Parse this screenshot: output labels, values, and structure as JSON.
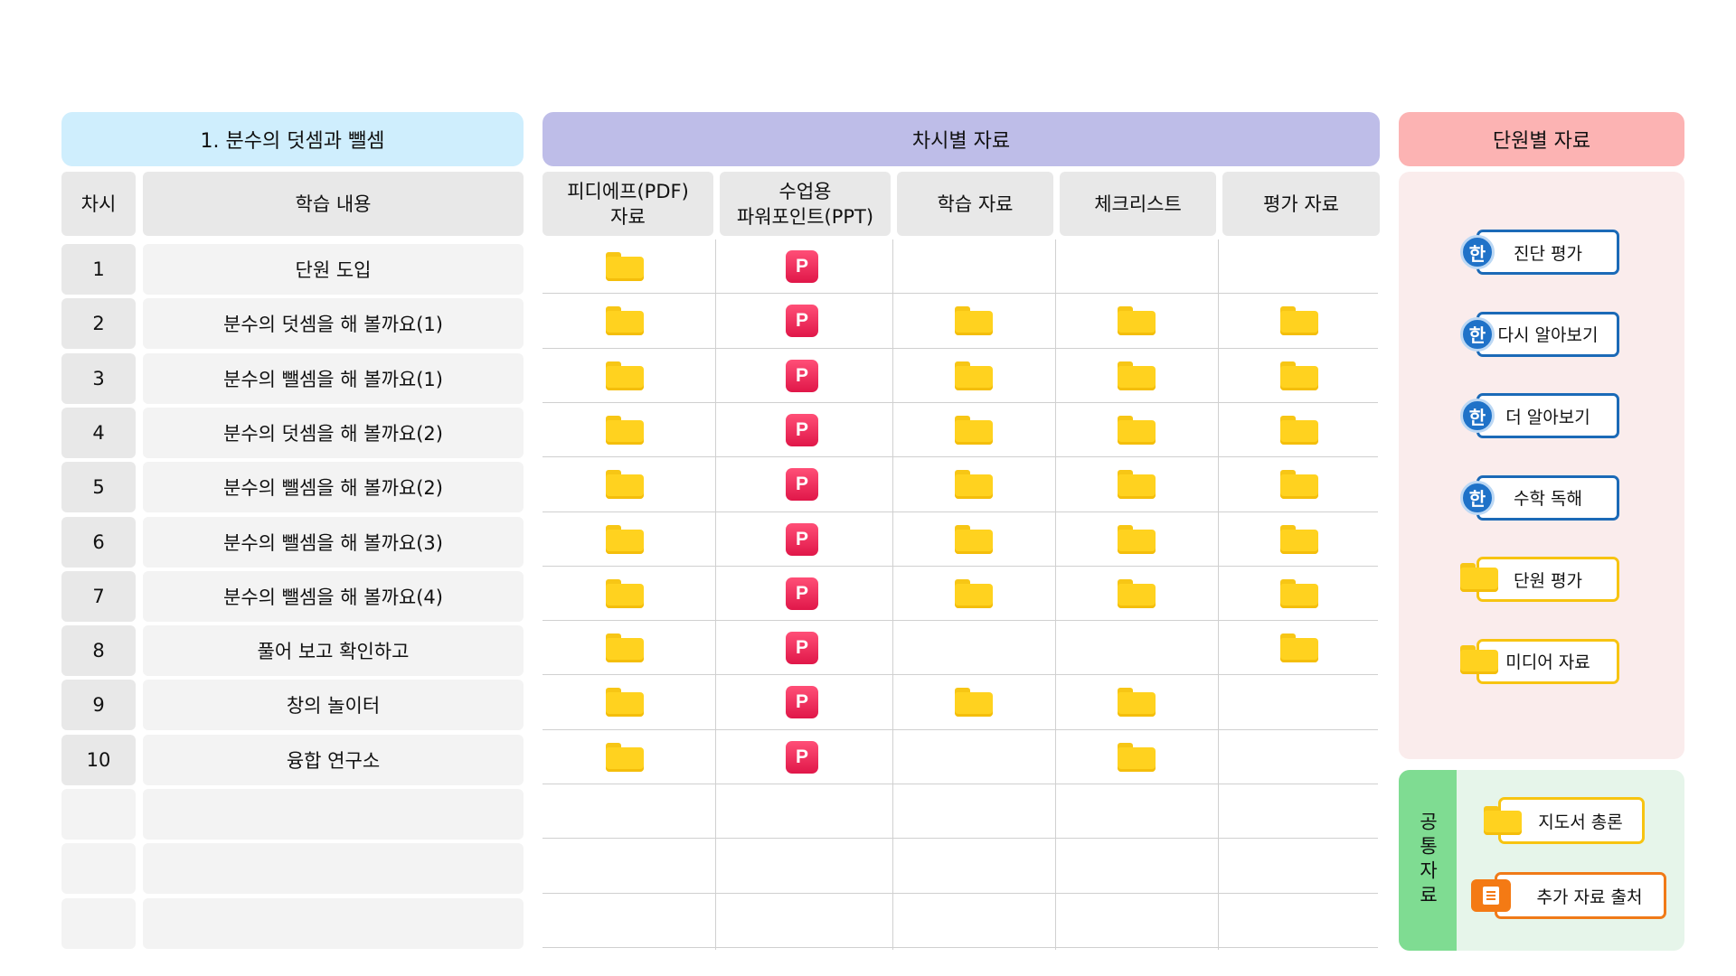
{
  "headers": {
    "unit_title": "1. 분수의 덧셈과 뺄셈",
    "lesson_materials": "차시별 자료",
    "unit_materials": "단원별 자료"
  },
  "columns": {
    "period": "차시",
    "content": "학습 내용",
    "pdf": "피디에프(PDF)\n자료",
    "ppt": "수업용\n파워포인트(PPT)",
    "study": "학습 자료",
    "checklist": "체크리스트",
    "evaluation": "평가 자료"
  },
  "rows": [
    {
      "num": "1",
      "content": "단원 도입",
      "pdf": true,
      "ppt": true,
      "study": false,
      "check": false,
      "eval": false
    },
    {
      "num": "2",
      "content": "분수의 덧셈을 해 볼까요(1)",
      "pdf": true,
      "ppt": true,
      "study": true,
      "check": true,
      "eval": true
    },
    {
      "num": "3",
      "content": "분수의 뺄셈을 해 볼까요(1)",
      "pdf": true,
      "ppt": true,
      "study": true,
      "check": true,
      "eval": true
    },
    {
      "num": "4",
      "content": "분수의 덧셈을 해 볼까요(2)",
      "pdf": true,
      "ppt": true,
      "study": true,
      "check": true,
      "eval": true
    },
    {
      "num": "5",
      "content": "분수의 뺄셈을 해 볼까요(2)",
      "pdf": true,
      "ppt": true,
      "study": true,
      "check": true,
      "eval": true
    },
    {
      "num": "6",
      "content": "분수의 뺄셈을 해 볼까요(3)",
      "pdf": true,
      "ppt": true,
      "study": true,
      "check": true,
      "eval": true
    },
    {
      "num": "7",
      "content": "분수의 뺄셈을 해 볼까요(4)",
      "pdf": true,
      "ppt": true,
      "study": true,
      "check": true,
      "eval": true
    },
    {
      "num": "8",
      "content": "풀어 보고 확인하고",
      "pdf": true,
      "ppt": true,
      "study": false,
      "check": false,
      "eval": true
    },
    {
      "num": "9",
      "content": "창의 놀이터",
      "pdf": true,
      "ppt": true,
      "study": true,
      "check": true,
      "eval": false
    },
    {
      "num": "10",
      "content": "융합 연구소",
      "pdf": true,
      "ppt": true,
      "study": false,
      "check": true,
      "eval": false
    }
  ],
  "ppt_glyph": "P",
  "unit_resources": [
    {
      "label": "진단 평가",
      "icon": "han-circle-icon",
      "style": "blue"
    },
    {
      "label": "다시 알아보기",
      "icon": "han-circle-icon",
      "style": "blue"
    },
    {
      "label": "더 알아보기",
      "icon": "han-circle-icon",
      "style": "blue"
    },
    {
      "label": "수학 독해",
      "icon": "han-circle-icon",
      "style": "blue"
    },
    {
      "label": "단원 평가",
      "icon": "folder-icon",
      "style": "yellow"
    },
    {
      "label": "미디어 자료",
      "icon": "folder-icon",
      "style": "yellow"
    }
  ],
  "han_glyph": "한",
  "common": {
    "label": "공통자료",
    "items": [
      {
        "label": "지도서 총론",
        "icon": "folder-icon",
        "style": "yellow"
      },
      {
        "label": "추가 자료 출처",
        "icon": "document-list-icon",
        "style": "orange"
      }
    ]
  },
  "colors": {
    "unit_header": "#cfeefd",
    "lesson_header": "#bebde8",
    "unit_res_header": "#fcb3b3",
    "folder": "#ffd21f",
    "ppt": "#e8234f",
    "blue_border": "#1b6ab7",
    "yellow_border": "#f7c411",
    "orange_border": "#f07a18",
    "common_label_bg": "#7fdc92"
  }
}
